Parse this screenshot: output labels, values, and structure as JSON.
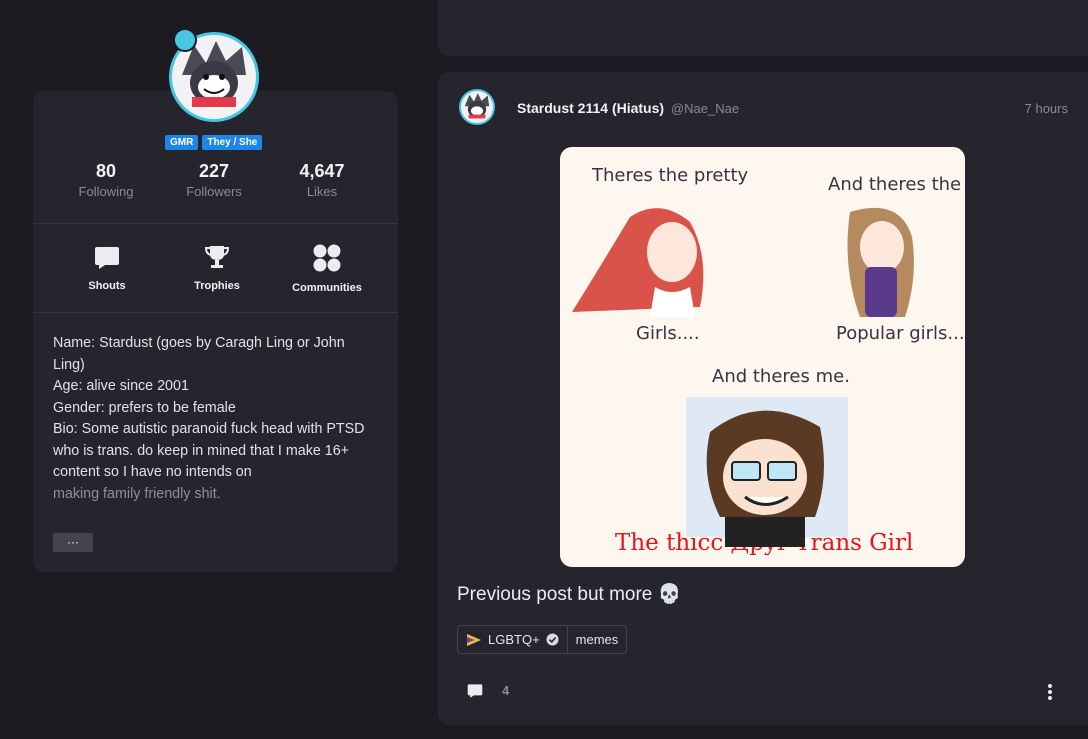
{
  "profile": {
    "tags": [
      "GMR",
      "They / She"
    ],
    "stats": [
      {
        "value": "80",
        "label": "Following"
      },
      {
        "value": "227",
        "label": "Followers"
      },
      {
        "value": "4,647",
        "label": "Likes"
      }
    ],
    "actions": [
      {
        "label": "Shouts",
        "icon": "chat-bubble-icon"
      },
      {
        "label": "Trophies",
        "icon": "trophy-icon"
      },
      {
        "label": "Communities",
        "icon": "communities-icon"
      }
    ],
    "bio": [
      "Name: Stardust (goes by Caragh Ling or John Ling)",
      "Age: alive since 2001",
      "Gender: prefers to be female",
      "Bio: Some autistic paranoid fuck head with PTSD who is trans. do keep in mined that I make 16+ content so I have no intends on"
    ],
    "bio_fade": "making family friendly shit.",
    "more_label": "···"
  },
  "post": {
    "author": "Stardust 2114 (Hiatus)",
    "handle": "@Nae_Nae",
    "time": "7 hours",
    "image": {
      "text1": "Theres the pretty",
      "text2": "Girls....",
      "text3": "And theres the",
      "text4": "Popular girls...",
      "text5": "And theres me.",
      "text6": "The thicc Дpyr Trans Girl"
    },
    "caption": "Previous post but more 💀",
    "chips": [
      {
        "label": "LGBTQ+",
        "icon": "pride-icon",
        "verified": true
      },
      {
        "label": "memes",
        "icon": "",
        "verified": false
      }
    ],
    "comment_count": "4"
  },
  "colors": {
    "accent": "#1e86e6",
    "avatar_ring": "#47c6e3",
    "meme_red": "#e8141b"
  }
}
